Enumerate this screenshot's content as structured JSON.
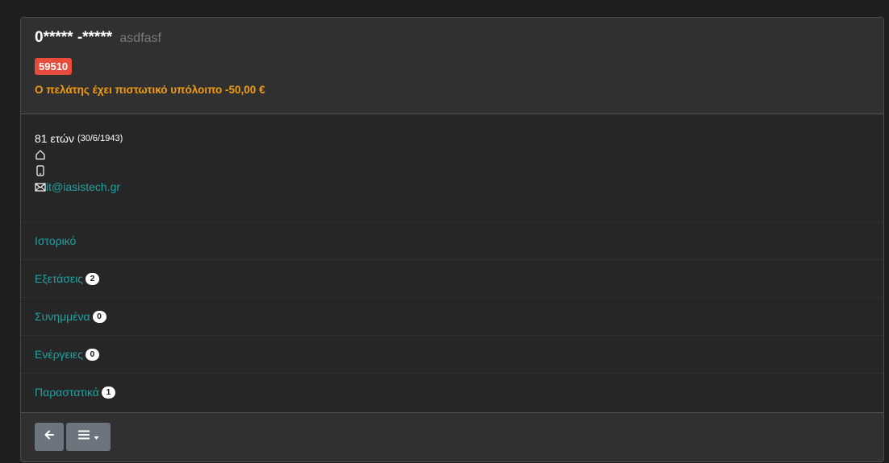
{
  "header": {
    "name": "0***** -*****",
    "subname": "asdfasf",
    "code": "59510",
    "balance_text": "Ο πελάτης έχει πιστωτικό υπόλοιπο -50,00 €"
  },
  "info": {
    "age": "81 ετών",
    "birthdate": "(30/6/1943)",
    "email": "it@iasistech.gr",
    "icons": [
      "home-icon",
      "mobile-icon",
      "envelope-icon"
    ]
  },
  "menu": {
    "items": [
      {
        "label": "Ιστορικό",
        "count": null
      },
      {
        "label": "Εξετάσεις",
        "count": "2"
      },
      {
        "label": "Συνημμένα",
        "count": "0"
      },
      {
        "label": "Ενέργειες",
        "count": "0"
      },
      {
        "label": "Παραστατικά",
        "count": "1"
      }
    ]
  },
  "footer": {
    "buttons": [
      "back-arrow-icon",
      "menu-hamburger-icon"
    ]
  },
  "colors": {
    "accent_link": "#1fa2a2",
    "warning": "#f39c12",
    "badge_red": "#e74c3c",
    "button_gray": "#6c757d"
  }
}
